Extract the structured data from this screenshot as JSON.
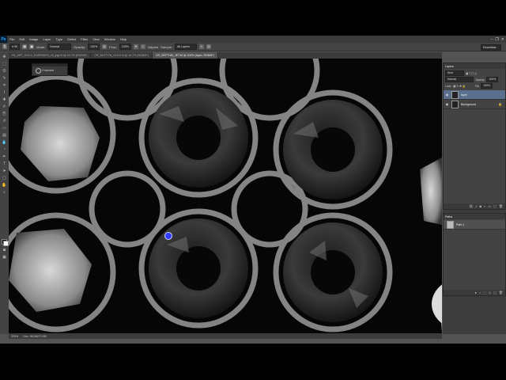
{
  "menubar": {
    "logo": "Ps",
    "items": [
      "File",
      "Edit",
      "Image",
      "Layer",
      "Type",
      "Select",
      "Filter",
      "View",
      "Window",
      "Help"
    ],
    "controls": [
      "–",
      "❐",
      "✕"
    ]
  },
  "options": {
    "mode_label": "Mode:",
    "mode_value": "Normal",
    "opacity_label": "Opacity:",
    "opacity_value": "100%",
    "flow_label": "Flow:",
    "flow_value": "100%",
    "aligned_label": "Aligned",
    "sample_label": "Sample:",
    "sample_value": "All Layers",
    "workspace": "Essentials"
  },
  "tabs": [
    {
      "label": "PA_ART_GOLD_EARRINGS_16_jrigi.tif @ 16.7% (RGB/8*)",
      "active": false
    },
    {
      "label": "CR_BUTTON_GOLD 8 @ 16.7% (RGB/8*)",
      "active": false
    },
    {
      "label": "CR_SEPTUM_JET.tif @ 200% (layer, RGB/8*)",
      "active": true
    }
  ],
  "floating_panel": {
    "label": "Channels"
  },
  "status": {
    "zoom": "200%",
    "doc": "Doc: 36.0M/72.0M"
  },
  "layers_panel": {
    "tab": "Layers",
    "kind_label": "Kind",
    "blend": "Normal",
    "opacity_label": "Opacity:",
    "opacity_value": "100%",
    "lock_label": "Lock:",
    "fill_label": "Fill:",
    "fill_value": "100%",
    "layers": [
      {
        "name": "layer",
        "selected": true
      },
      {
        "name": "Background",
        "selected": false
      }
    ]
  },
  "paths_panel": {
    "tab": "Paths",
    "paths": [
      {
        "name": "Path 1"
      }
    ]
  },
  "colors": {
    "accent": "#5b6f8e",
    "cursor": "#2f3cff"
  }
}
